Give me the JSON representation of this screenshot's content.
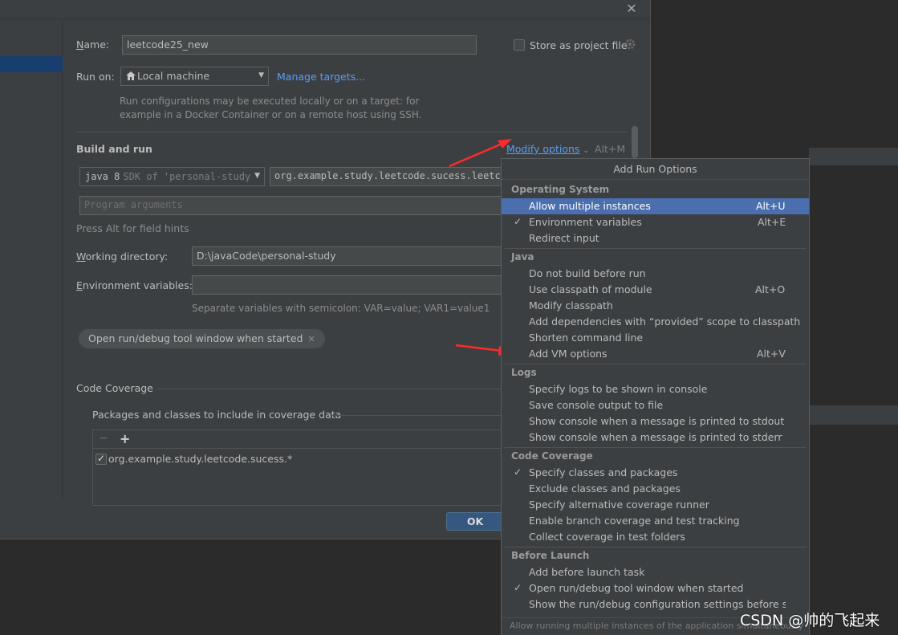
{
  "dialog": {
    "close_glyph": "✕",
    "name_label": "Name:",
    "name_value": "leetcode25_new",
    "store_label": "Store as project file",
    "run_on_label": "Run on:",
    "run_on_value": "Local machine",
    "manage_targets": "Manage targets...",
    "run_hint_line1": "Run configurations may be executed locally or on a target: for",
    "run_hint_line2": "example in a Docker Container or on a remote host using SSH.",
    "build_and_run": "Build and run",
    "modify_options": "Modify options",
    "modify_options_shortcut": "Alt+M",
    "jdk_value_main": "java 8",
    "jdk_value_detail": "SDK of 'personal-study",
    "main_class_value": "org.example.study.leetcode.sucess.leetco",
    "program_args_placeholder": "Program arguments",
    "press_alt_hint": "Press Alt for field hints",
    "working_dir_label": "Working directory:",
    "working_dir_value": "D:\\javaCode\\personal-study",
    "env_vars_label": "Environment variables:",
    "env_vars_value": "",
    "env_hint": "Separate variables with semicolon: VAR=value; VAR1=value1",
    "open_tool_window_tag": "Open run/debug tool window when started",
    "tag_close_glyph": "✕",
    "code_coverage": "Code Coverage",
    "packages_label": "Packages and classes to include in coverage data",
    "remove_glyph": "−",
    "add_glyph": "+",
    "coverage_entry": "org.example.study.leetcode.sucess.*",
    "ok_button": "OK"
  },
  "popup": {
    "title": "Add Run Options",
    "sections": [
      {
        "header": "Operating System",
        "items": [
          {
            "label": "Allow multiple instances",
            "shortcut": "Alt+U",
            "checked": false,
            "highlighted": true
          },
          {
            "label": "Environment variables",
            "shortcut": "Alt+E",
            "checked": true
          },
          {
            "label": "Redirect input",
            "shortcut": "",
            "checked": false
          }
        ]
      },
      {
        "header": "Java",
        "items": [
          {
            "label": "Do not build before run",
            "shortcut": "",
            "checked": false
          },
          {
            "label": "Use classpath of module",
            "shortcut": "Alt+O",
            "checked": false
          },
          {
            "label": "Modify classpath",
            "shortcut": "",
            "checked": false
          },
          {
            "label": "Add dependencies with “provided” scope to classpath",
            "shortcut": "",
            "checked": false
          },
          {
            "label": "Shorten command line",
            "shortcut": "",
            "checked": false
          },
          {
            "label": "Add VM options",
            "shortcut": "Alt+V",
            "checked": false
          }
        ]
      },
      {
        "header": "Logs",
        "items": [
          {
            "label": "Specify logs to be shown in console",
            "shortcut": "",
            "checked": false
          },
          {
            "label": "Save console output to file",
            "shortcut": "",
            "checked": false
          },
          {
            "label": "Show console when a message is printed to stdout",
            "shortcut": "",
            "checked": false
          },
          {
            "label": "Show console when a message is printed to stderr",
            "shortcut": "",
            "checked": false
          }
        ]
      },
      {
        "header": "Code Coverage",
        "items": [
          {
            "label": "Specify classes and packages",
            "shortcut": "",
            "checked": true
          },
          {
            "label": "Exclude classes and packages",
            "shortcut": "",
            "checked": false
          },
          {
            "label": "Specify alternative coverage runner",
            "shortcut": "",
            "checked": false
          },
          {
            "label": "Enable branch coverage and test tracking",
            "shortcut": "",
            "checked": false
          },
          {
            "label": "Collect coverage in test folders",
            "shortcut": "",
            "checked": false
          }
        ]
      },
      {
        "header": "Before Launch",
        "items": [
          {
            "label": "Add before launch task",
            "shortcut": "",
            "checked": false
          },
          {
            "label": "Open run/debug tool window when started",
            "shortcut": "",
            "checked": true
          },
          {
            "label": "Show the run/debug configuration settings before star",
            "shortcut": "",
            "checked": false
          }
        ]
      }
    ],
    "check_glyph": "✓",
    "footer": "Allow running multiple instances of the application simultaneously"
  },
  "watermark": "CSDN @帅的飞起来",
  "colors": {
    "highlight": "#4b6eaf",
    "link": "#589df6",
    "annotation_arrow": "#ff2a2a"
  },
  "icons": [
    "close-icon",
    "home-icon",
    "gear-icon",
    "chevron-down-icon",
    "checkmark-icon",
    "add-icon",
    "remove-icon"
  ]
}
